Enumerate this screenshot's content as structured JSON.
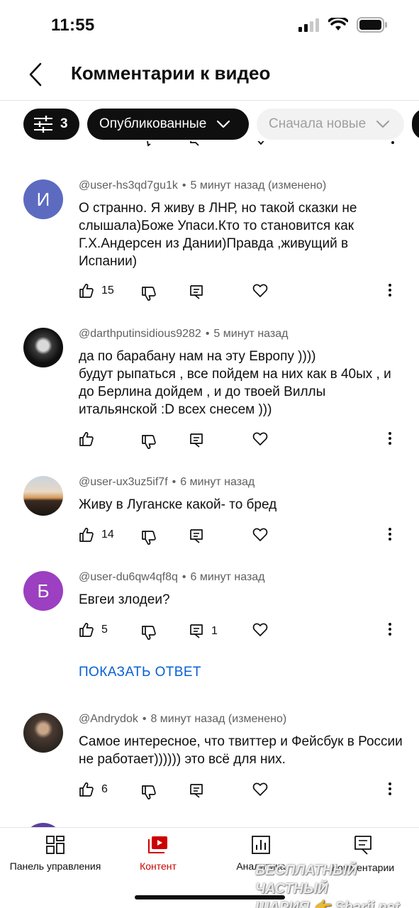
{
  "status_bar": {
    "time": "11:55",
    "icons": [
      "signal-icon",
      "wifi-icon",
      "battery-icon"
    ]
  },
  "header": {
    "title": "Комментарии к видео",
    "back_icon": "chevron-left-icon"
  },
  "filters": {
    "filter_count": "3",
    "published_label": "Опубликованные",
    "sort_label": "Сначала новые"
  },
  "comments": [
    {
      "author": "@user-hs3qd7gu1k",
      "time": "5 минут назад (изменено)",
      "avatar_letter": "И",
      "avatar_color": "#5c6bc0",
      "text": "О странно.  Я живу в ЛНР, но такой сказки не слышала)Боже Упаси.Кто то становится как Г.Х.Андерсен из Дании)Правда ,живущий в Испании)",
      "likes": "15",
      "replies": ""
    },
    {
      "author": "@darthputinsidious9282",
      "time": "5 минут назад",
      "avatar_letter": "",
      "avatar_color": "#1b1b1b",
      "text": "да по барабану нам на эту Европу ))))\nбудут рыпаться , все пойдем на них как в 40ых , и до Берлина дойдем , и до твоей Виллы итальянской :D всех снесем )))",
      "likes": "",
      "replies": ""
    },
    {
      "author": "@user-ux3uz5if7f",
      "time": "6 минут назад",
      "avatar_letter": "",
      "avatar_color": "#8a7b6a",
      "text": "Живу в Луганске какой- то бред",
      "likes": "14",
      "replies": ""
    },
    {
      "author": "@user-du6qw4qf8q",
      "time": "6 минут назад",
      "avatar_letter": "Б",
      "avatar_color": "#9c3fc0",
      "text": "Евгеи злодеи?",
      "likes": "5",
      "replies": "1"
    },
    {
      "author": "@Andrydok",
      "time": "8 минут назад (изменено)",
      "avatar_letter": "",
      "avatar_color": "#4a3b32",
      "text": "Самое интересное, что твиттер и Фейсбук в России не работает)))))) это всё для них.",
      "likes": "6",
      "replies": ""
    }
  ],
  "show_replies_label": "ПОКАЗАТЬ ОТВЕТ",
  "bottom_nav": [
    {
      "label": "Панель управления",
      "icon": "dashboard-icon"
    },
    {
      "label": "Контент",
      "icon": "content-icon",
      "active": true
    },
    {
      "label": "Аналитика",
      "icon": "analytics-icon"
    },
    {
      "label": "Комментарии",
      "icon": "comments-icon"
    }
  ],
  "watermark": {
    "line1": "БЕСПЛАТНЫЙ ЧАСТНЫЙ",
    "line2": "ШАРИЯ 👉 Sharij.net"
  },
  "colors": {
    "accent_red": "#cc0000",
    "link_blue": "#065fd4",
    "chip_dark": "#0f0f0f"
  }
}
